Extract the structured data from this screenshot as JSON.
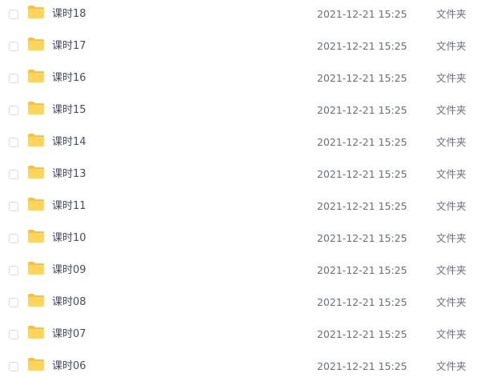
{
  "icons": {
    "row_folder": "folder-icon",
    "row_checkbox": "checkbox"
  },
  "colors": {
    "folder": "#ffd659",
    "folder_back": "#f7c33c",
    "text": "#424e67",
    "meta_text": "#666f80"
  },
  "files": [
    {
      "name": "课时18",
      "modified": "2021-12-21 15:25",
      "type": "文件夹"
    },
    {
      "name": "课时17",
      "modified": "2021-12-21 15:25",
      "type": "文件夹"
    },
    {
      "name": "课时16",
      "modified": "2021-12-21 15:25",
      "type": "文件夹"
    },
    {
      "name": "课时15",
      "modified": "2021-12-21 15:25",
      "type": "文件夹"
    },
    {
      "name": "课时14",
      "modified": "2021-12-21 15:25",
      "type": "文件夹"
    },
    {
      "name": "课时13",
      "modified": "2021-12-21 15:25",
      "type": "文件夹"
    },
    {
      "name": "课时11",
      "modified": "2021-12-21 15:25",
      "type": "文件夹"
    },
    {
      "name": "课时10",
      "modified": "2021-12-21 15:25",
      "type": "文件夹"
    },
    {
      "name": "课时09",
      "modified": "2021-12-21 15:25",
      "type": "文件夹"
    },
    {
      "name": "课时08",
      "modified": "2021-12-21 15:25",
      "type": "文件夹"
    },
    {
      "name": "课时07",
      "modified": "2021-12-21 15:25",
      "type": "文件夹"
    },
    {
      "name": "课时06",
      "modified": "2021-12-21 15:25",
      "type": "文件夹"
    }
  ]
}
